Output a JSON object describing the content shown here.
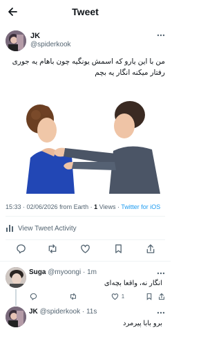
{
  "header": {
    "title": "Tweet"
  },
  "tweet": {
    "name": "JK",
    "handle": "@spiderkook",
    "text": "من با این یارو که اسمش یونگیه چون باهام یه جوری رفتار میکنه انگار یه بچم",
    "time": "15:33 · 02/06/2026 from Earth · ",
    "views_count": "1",
    "views_label": " Views · ",
    "client": "Twitter for iOS",
    "activity_label": "View Tweet Activity"
  },
  "replies": [
    {
      "name": "Suga",
      "handle": "@myoongi",
      "time": " · 1m",
      "text": "انگار نه، واقعا بچه‌ای",
      "likes": "1"
    },
    {
      "name": "JK",
      "handle": "@spiderkook",
      "time": " · 11s",
      "text": "برو بابا پیرمرد"
    }
  ],
  "icons": [
    "back-arrow-icon",
    "more-icon",
    "reply-icon",
    "retweet-icon",
    "like-icon",
    "bookmark-icon",
    "share-icon",
    "activity-icon"
  ],
  "colors": {
    "accent": "#1d9bf0",
    "muted": "#536471",
    "text": "#0f1419",
    "divider": "#eff3f4"
  }
}
